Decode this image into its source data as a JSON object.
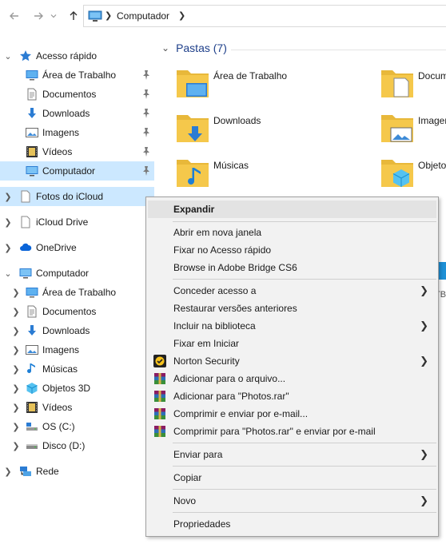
{
  "nav": {
    "back_icon": "arrow-left-icon",
    "forward_icon": "arrow-right-icon",
    "recent_icon": "chevron-down-icon",
    "up_icon": "arrow-up-icon",
    "address_crumb": "Computador"
  },
  "sidebar": {
    "quick_access": "Acesso rápido",
    "quick_items": [
      {
        "label": "Área de Trabalho",
        "icon": "desktop-icon"
      },
      {
        "label": "Documentos",
        "icon": "documents-icon"
      },
      {
        "label": "Downloads",
        "icon": "downloads-icon"
      },
      {
        "label": "Imagens",
        "icon": "pictures-icon"
      },
      {
        "label": "Vídeos",
        "icon": "videos-icon"
      },
      {
        "label": "Computador",
        "icon": "computer-icon"
      }
    ],
    "icloud_photos": "Fotos do iCloud",
    "icloud_drive": "iCloud Drive",
    "onedrive": "OneDrive",
    "computer": "Computador",
    "computer_items": [
      {
        "label": "Área de Trabalho",
        "icon": "desktop-icon"
      },
      {
        "label": "Documentos",
        "icon": "documents-icon"
      },
      {
        "label": "Downloads",
        "icon": "downloads-icon"
      },
      {
        "label": "Imagens",
        "icon": "pictures-icon"
      },
      {
        "label": "Músicas",
        "icon": "music-icon"
      },
      {
        "label": "Objetos 3D",
        "icon": "3d-objects-icon"
      },
      {
        "label": "Vídeos",
        "icon": "videos-icon"
      },
      {
        "label": "OS (C:)",
        "icon": "os-drive-icon"
      },
      {
        "label": "Disco (D:)",
        "icon": "disk-drive-icon"
      }
    ],
    "network": "Rede"
  },
  "main": {
    "group_title": "Pastas (7)",
    "folders": [
      {
        "name": "Área de Trabalho",
        "icon": "desktop-folder-icon"
      },
      {
        "name": "Docum",
        "icon": "documents-folder-icon"
      },
      {
        "name": "Downloads",
        "icon": "downloads-folder-icon"
      },
      {
        "name": "Imager",
        "icon": "pictures-folder-icon"
      },
      {
        "name": "Músicas",
        "icon": "music-folder-icon"
      },
      {
        "name": "Objetos",
        "icon": "3d-objects-folder-icon"
      }
    ],
    "peek_1": "(",
    "peek_2": "TB"
  },
  "context_menu": {
    "items": [
      {
        "label": "Expandir",
        "bold": true
      },
      {
        "label": "Abrir em nova janela"
      },
      {
        "label": "Fixar no Acesso rápido"
      },
      {
        "label": "Browse in Adobe Bridge CS6"
      },
      {
        "label": "Conceder acesso a",
        "submenu": true
      },
      {
        "label": "Restaurar versões anteriores"
      },
      {
        "label": "Incluir na biblioteca",
        "submenu": true
      },
      {
        "label": "Fixar em Iniciar"
      },
      {
        "label": "Norton Security",
        "submenu": true,
        "icon": "norton-icon"
      },
      {
        "label": "Adicionar para o arquivo...",
        "icon": "winrar-icon"
      },
      {
        "label": "Adicionar para \"Photos.rar\"",
        "icon": "winrar-icon"
      },
      {
        "label": "Comprimir e enviar por e-mail...",
        "icon": "winrar-icon"
      },
      {
        "label": "Comprimir para \"Photos.rar\" e enviar por e-mail",
        "icon": "winrar-icon"
      },
      {
        "label": "Enviar para",
        "submenu": true
      },
      {
        "label": "Copiar"
      },
      {
        "label": "Novo",
        "submenu": true
      },
      {
        "label": "Propriedades"
      }
    ]
  },
  "colors": {
    "selection": "#cce8ff",
    "group_title": "#1e3f8a",
    "menu_bg": "#f2f2f2",
    "folder_yellow": "#f5c84b",
    "accent_blue": "#1e90d6"
  }
}
